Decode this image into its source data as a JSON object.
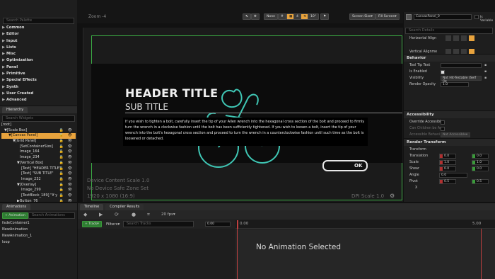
{
  "palette": {
    "search_placeholder": "Search Palette",
    "categories": [
      "Common",
      "Editor",
      "Input",
      "Lists",
      "Misc",
      "Optimization",
      "Panel",
      "Primitive",
      "Special Effects",
      "Synth",
      "User Created",
      "Advanced"
    ]
  },
  "hierarchy": {
    "tab": "Hierarchy",
    "search_placeholder": "Search Widgets",
    "items": [
      {
        "label": "[root]",
        "indent": 0,
        "sel": false
      },
      {
        "label": "▼[Scale Box]",
        "indent": 4,
        "sel": false
      },
      {
        "label": "▼[Canvas Panel]",
        "indent": 10,
        "sel": true
      },
      {
        "label": "▼[Grid Panel]",
        "indent": 16,
        "sel": false
      },
      {
        "label": "[SetContainerSize]",
        "indent": 26,
        "sel": false
      },
      {
        "label": "Image_164",
        "indent": 26,
        "sel": false
      },
      {
        "label": "Image_234",
        "indent": 26,
        "sel": false
      },
      {
        "label": "▼[Vertical Box]",
        "indent": 22,
        "sel": false
      },
      {
        "label": "[Text] \"HEADER TITLE\"",
        "indent": 28,
        "sel": false
      },
      {
        "label": "[Text] \"SUB TITLE\"",
        "indent": 28,
        "sel": false
      },
      {
        "label": "Image_232",
        "indent": 28,
        "sel": false
      },
      {
        "label": "▼[Overlay]",
        "indent": 22,
        "sel": false
      },
      {
        "label": "Image_299",
        "indent": 28,
        "sel": false
      },
      {
        "label": "[TextBlock_189] \"If y",
        "indent": 28,
        "sel": false
      },
      {
        "label": "▶Button_76",
        "indent": 22,
        "sel": false
      }
    ]
  },
  "toolbar": {
    "zoom": "Zoom -4",
    "none_label": "None",
    "screen_size": "Screen Size▾",
    "fill_screen": "Fill Screen▾"
  },
  "designer": {
    "header_title": "HEADER TITLE",
    "sub_title": "SUB TITLE",
    "body_text": "If you wish to tighten a bolt, carefully insert the tip of your Allen wrench into the hexagonal cross section of the bolt and proceed to firmly turn the wrench in a clockwise fashion until the bolt has been sufficiently tightened. If you wish to loosen a bolt, insert the tip of your wrench into the bolt's hexagonal cross section and proceed to turn the wrench in a counterclockwise fashion until such time as the bolt is loosened or detached.",
    "ok_label": "OK",
    "device_scale": "Device Content Scale 1.0",
    "safe_zone": "No Device Safe Zone Set",
    "resolution": "1920 x 1080 (16:9)",
    "dpi_scale": "DPI Scale 1.0"
  },
  "details": {
    "name_value": "CanvasPanel_0",
    "is_variable": "Is Variable",
    "search_placeholder": "Search Details",
    "horizontal_align": "Horizontal Align",
    "vertical_align": "Vertical Alignme",
    "behavior": "Behavior",
    "tooltip_text": "Tool Tip Text",
    "is_enabled": "Is Enabled",
    "visibility": "Visibility",
    "visibility_value": "Not Hit-Testable (Self O▾",
    "render_opacity": "Render Opacity",
    "render_opacity_value": "1.0",
    "accessibility": "Accessibility",
    "override_accessible": "Override Accessible",
    "can_children": "Can Children be Acc",
    "accessible_behavior": "Accessible Behavi",
    "accessible_value": "Not Accessible▾",
    "render_transform": "Render Transform",
    "transform": "Transform",
    "translation": "Translation",
    "translation_x": "0.0",
    "translation_y": "0.0",
    "scale": "Scale",
    "scale_x": "1.0",
    "scale_y": "1.0",
    "shear": "Shear",
    "shear_x": "0.0",
    "shear_y": "0.0",
    "angle": "Angle",
    "angle_value": "0.0",
    "pivot": "Pivot",
    "pivot_x": "0.5",
    "pivot_y": "0.5",
    "x_label": "X"
  },
  "animations": {
    "tab": "Animations",
    "add_button": "+ Animation",
    "search_placeholder": "Search Animations",
    "list": [
      "fadeContainer1",
      "NewAnimation",
      "NewAnimation_1",
      "loop"
    ]
  },
  "timeline": {
    "tab_timeline": "Timeline",
    "tab_compiler": "Compiler Results",
    "fps": "20 fps▾",
    "track_button": "+ Track▾",
    "filters": "Filters▾",
    "search_placeholder": "Search Tracks",
    "time_value": "0.00",
    "ruler_start": "0.00",
    "ruler_end": "5.00",
    "empty_message": "No Animation Selected"
  },
  "colors": {
    "accent": "#e8a33d",
    "outline": "#3aa843",
    "bike": "#3fc6b4"
  }
}
